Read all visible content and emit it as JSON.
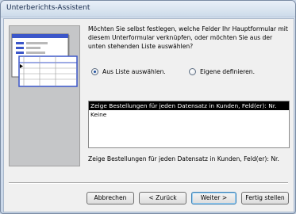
{
  "window": {
    "title": "Unterberichts-Assistent"
  },
  "prompt": "Möchten Sie selbst festlegen, welche Felder Ihr Hauptformular mit diesem Unterformular verknüpfen, oder möchten Sie aus der unten stehenden Liste auswählen?",
  "options": {
    "from_list": {
      "label": "Aus Liste auswählen.",
      "selected": true
    },
    "define_own": {
      "label": "Eigene definieren.",
      "selected": false
    }
  },
  "list": {
    "items": [
      {
        "label": "Zeige Bestellungen für jeden Datensatz in Kunden, Feld(er): Nr.",
        "selected": true
      },
      {
        "label": "Keine",
        "selected": false
      }
    ]
  },
  "selected_description": "Zeige Bestellungen für jeden Datensatz in Kunden, Feld(er): Nr.",
  "buttons": {
    "cancel": "Abbrechen",
    "back": "< Zurück",
    "next": "Weiter >",
    "finish": "Fertig stellen"
  },
  "colors": {
    "selection_bg": "#000000",
    "radio_dot": "#1d4f9e",
    "illustration_bg": "#c5c6c8",
    "illustration_frame_accent": "#3b56c9"
  }
}
